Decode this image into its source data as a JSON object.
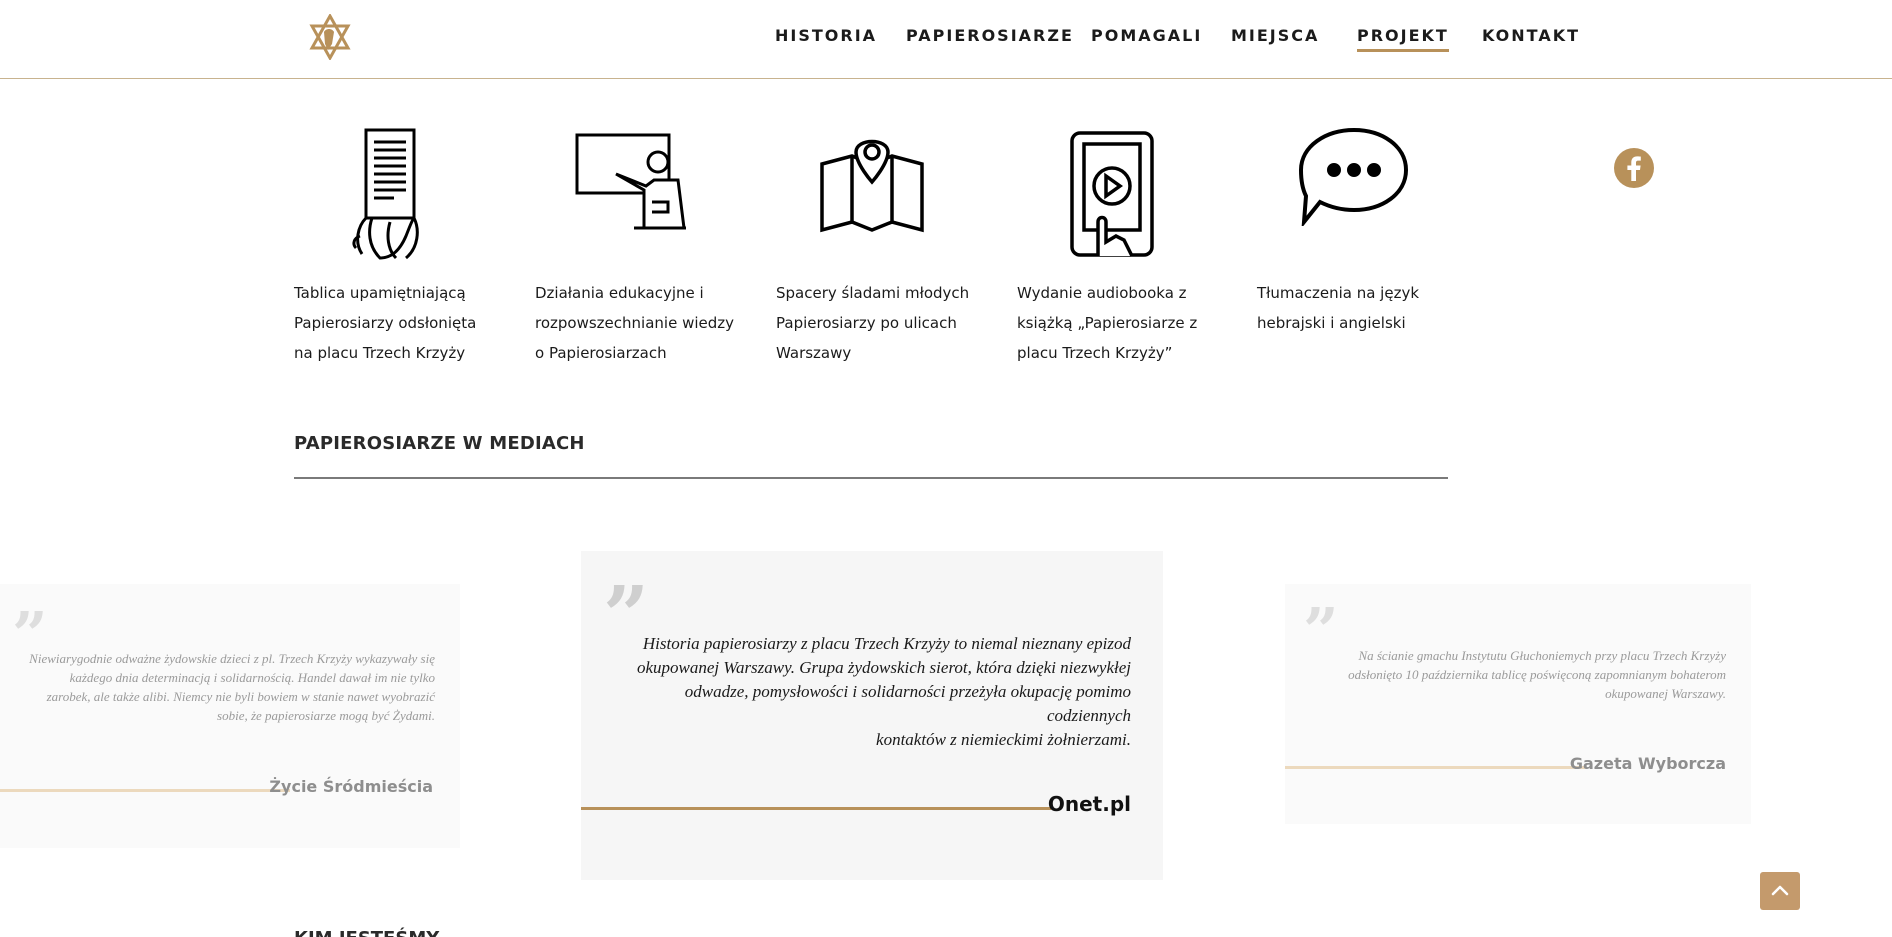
{
  "header": {
    "logo_icon": "star-of-david-logo-icon",
    "nav": [
      "HISTORIA",
      "PAPIEROSIARZE",
      "POMAGALI",
      "MIEJSCA",
      "PROJEKT",
      "KONTAKT"
    ],
    "active_nav": "PROJEKT"
  },
  "features": [
    {
      "icon": "document-scroll-icon",
      "lines": [
        "Tablica upamiętniającą",
        "Papierosiarzy odsłonięta",
        "na placu Trzech Krzyży"
      ]
    },
    {
      "icon": "presentation-board-icon",
      "lines": [
        "Działania edukacyjne i",
        "rozpowszechnianie wiedzy",
        "o Papierosiarzach"
      ]
    },
    {
      "icon": "map-pin-icon",
      "lines": [
        "Spacery śladami młodych",
        "Papierosiarzy po ulicach",
        "Warszawy"
      ]
    },
    {
      "icon": "tablet-play-icon",
      "lines": [
        "Wydanie audiobooka z",
        "książką „Papierosiarze z",
        "placu Trzech Krzyży”"
      ]
    },
    {
      "icon": "speech-bubble-icon",
      "lines": [
        "Tłumaczenia na język",
        "hebrajski i angielski"
      ]
    }
  ],
  "social": {
    "facebook_icon": "facebook-icon"
  },
  "media": {
    "title": "PAPIEROSIARZE W MEDIACH",
    "quotes": [
      {
        "lines": [
          "Niewiarygodnie odważne żydowskie dzieci z pl. Trzech Krzyży wykazywały się",
          "każdego dnia determinacją i solidarnością. Handel dawał im nie tylko",
          "zarobek, ale także alibi. Niemcy nie byli bowiem w stanie nawet wyobrazić",
          "sobie, że papierosiarze mogą być Żydami."
        ],
        "source": "Życie Śródmieścia"
      },
      {
        "lines": [
          "Historia papierosiarzy z placu Trzech Krzyży to niemal nieznany epizod",
          "okupowanej Warszawy. Grupa żydowskich sierot, która dzięki niezwykłej",
          "odwadze, pomysłowości i solidarności przeżyła okupację pomimo codziennych",
          "kontaktów z niemieckimi żołnierzami."
        ],
        "source": "Onet.pl"
      },
      {
        "lines": [
          "Na ścianie gmachu Instytutu Głuchoniemych przy placu Trzech Krzyży",
          "odsłonięto 10 października tablicę poświęconą zapomnianym bohaterom",
          "okupowanej Warszawy."
        ],
        "source": "Gazeta Wyborcza"
      }
    ]
  },
  "next_section": {
    "title": "KIM JESTEŚMY"
  },
  "scroll_top": {
    "icon": "chevron-up-icon"
  },
  "colors": {
    "accent": "#b8915a",
    "accent_light": "#ecd9bd",
    "card_bg": "#f6f6f6"
  }
}
